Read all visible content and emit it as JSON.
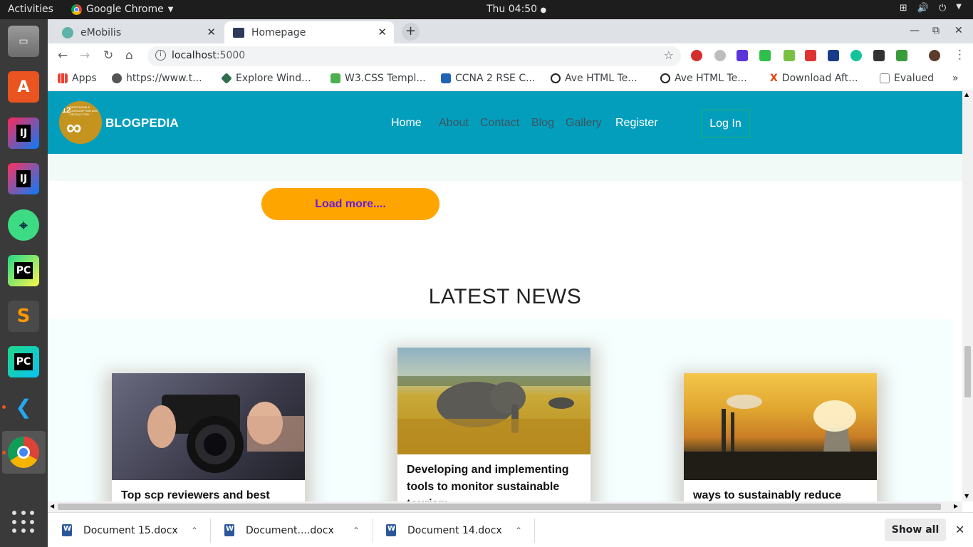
{
  "topbar": {
    "activities": "Activities",
    "app_name": "Google Chrome",
    "clock": "Thu 04:50"
  },
  "tabs": [
    {
      "title": "eMobilis",
      "active": false
    },
    {
      "title": "Homepage",
      "active": true
    }
  ],
  "omnibox": {
    "url_host": "localhost",
    "url_port": ":5000"
  },
  "bookmarks": [
    {
      "label": "Apps",
      "icon": "apps-grid-icon"
    },
    {
      "label": "https://www.t...",
      "icon": "globe-icon"
    },
    {
      "label": "Explore Wind...",
      "icon": "diamond-icon"
    },
    {
      "label": "W3.CSS Templ...",
      "icon": "w3-icon"
    },
    {
      "label": "CCNA 2 RSE C...",
      "icon": "ccna-icon"
    },
    {
      "label": "Ave HTML Te...",
      "icon": "ave-icon"
    },
    {
      "label": "Ave HTML Te...",
      "icon": "ave-icon"
    },
    {
      "label": "Download Aft...",
      "icon": "x-icon"
    },
    {
      "label": "Evalued",
      "icon": "chart-icon"
    }
  ],
  "site": {
    "logo_number": "12",
    "logo_text": "RESPONSIBLE CONSUMPTION AND PRODUCTION",
    "logo_symbol": "∞",
    "brand": "BLOGPEDIA",
    "nav": [
      "Home",
      "About",
      "Contact",
      "Blog",
      "Gallery",
      "Register"
    ],
    "login": "Log In",
    "load_more": "Load more....",
    "news_heading": "LATEST NEWS",
    "cards": [
      {
        "title": "Top scp reviewers and best paper",
        "image": "camera-photo"
      },
      {
        "title": "Developing and implementing tools to monitor sustainable tourism",
        "image": "elephant-photo"
      },
      {
        "title": "ways to sustainably reduce waste",
        "image": "factory-photo"
      }
    ]
  },
  "downloads": [
    {
      "name": "Document 15.docx"
    },
    {
      "name": "Document....docx"
    },
    {
      "name": "Document 14.docx"
    }
  ],
  "shelf": {
    "show_all": "Show all"
  },
  "colors": {
    "header_bg": "#049ebd",
    "load_more_bg": "#ffa500",
    "load_more_text": "#6a1bd6",
    "login_border": "#19b26b"
  }
}
